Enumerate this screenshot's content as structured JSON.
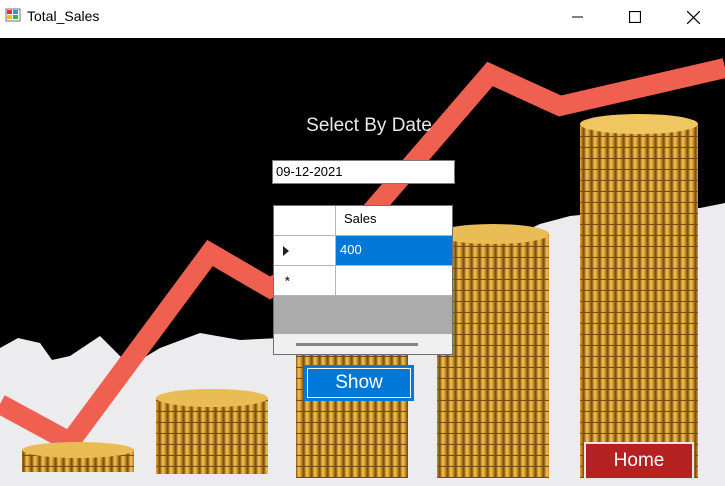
{
  "window": {
    "title": "Total_Sales",
    "controls": {
      "minimize": "–",
      "maximize": "☐",
      "close": "✕"
    }
  },
  "form": {
    "heading": "Select By Date",
    "date_value": "09-12-2021"
  },
  "grid": {
    "columns": [
      "Sales"
    ],
    "rows": [
      {
        "sales": "400",
        "selected": true
      }
    ],
    "new_row_marker": "*"
  },
  "buttons": {
    "show": "Show",
    "home": "Home"
  },
  "colors": {
    "accent": "#0078d7",
    "home": "#b52020",
    "trend_line": "#f06050",
    "coin": "#d9a43a"
  }
}
